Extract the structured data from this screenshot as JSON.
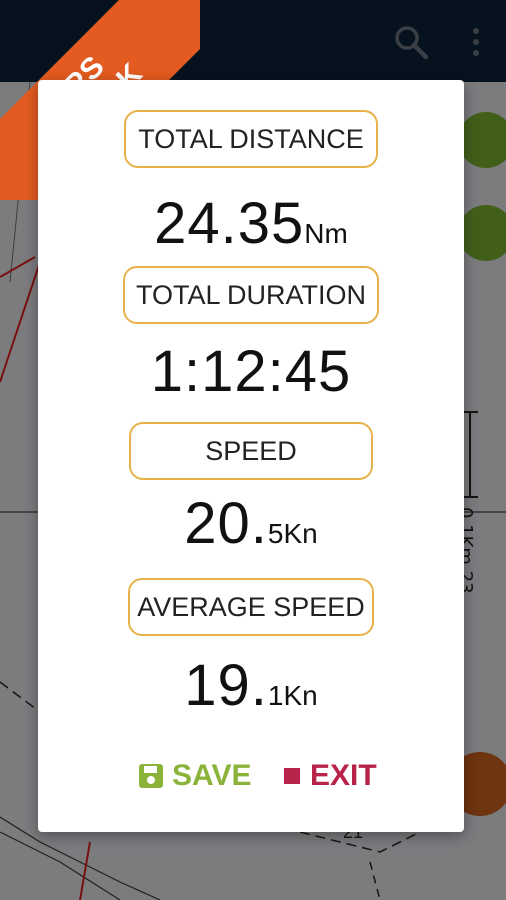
{
  "ribbon": {
    "line1": "GPS",
    "line2": "TRACK"
  },
  "map": {
    "scale_label": "0.1Km",
    "scale_num": "23",
    "marker_text": "21"
  },
  "dialog": {
    "total_distance": {
      "label": "TOTAL DISTANCE",
      "value": "24.35",
      "unit": "Nm"
    },
    "total_duration": {
      "label": "TOTAL DURATION",
      "value": "1:12:45"
    },
    "speed": {
      "label": "SPEED",
      "value": "20.",
      "value_small": "5",
      "unit": "Kn"
    },
    "average_speed": {
      "label": "AVERAGE SPEED",
      "value": "19.",
      "value_small": "1",
      "unit": "Kn"
    },
    "actions": {
      "save": "SAVE",
      "exit": "EXIT"
    }
  },
  "colors": {
    "ribbon": "#e35b20",
    "pill_border": "#e8b24a",
    "save": "#8bb33a",
    "exit": "#b8234a",
    "appbar": "#0b1f33"
  },
  "icons": {
    "search": "search-icon",
    "more": "more-vert-icon",
    "save": "floppy-disk-icon",
    "exit": "stop-square-icon",
    "locate": "gps-locate-icon"
  }
}
